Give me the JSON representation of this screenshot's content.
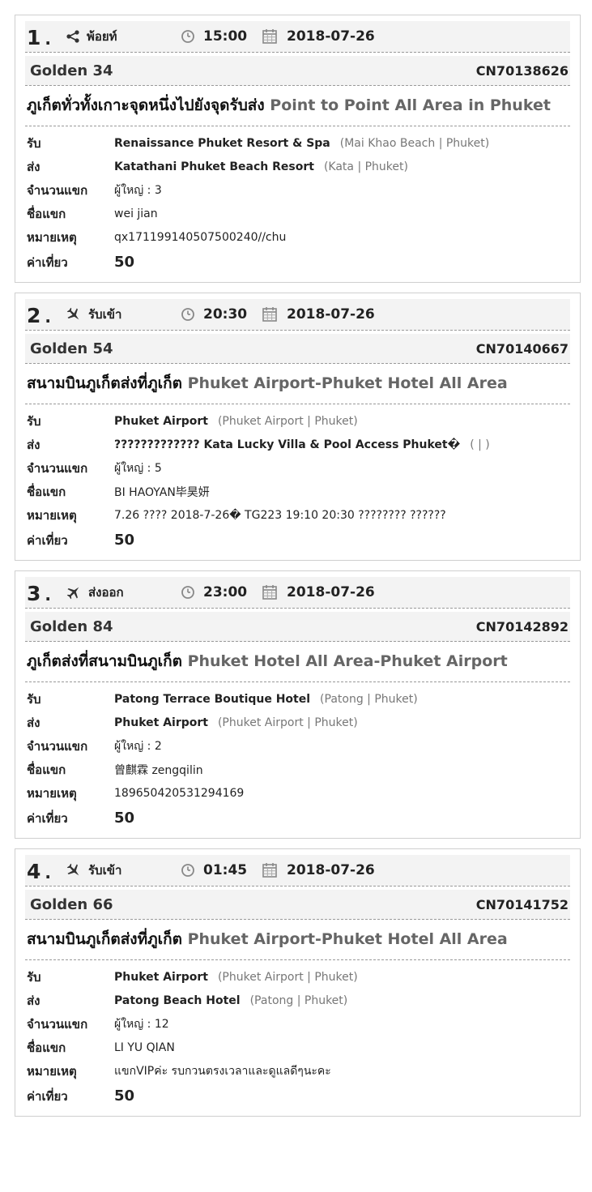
{
  "labels": {
    "pickup": "รับ",
    "dropoff": "ส่ง",
    "guests": "จำนวนแขก",
    "guest_name": "ชื่อแขก",
    "note": "หมายเหตุ",
    "fare": "ค่าเที่ยว"
  },
  "jobs": [
    {
      "number": "1",
      "dot": ".",
      "type_label": "พ้อยท์",
      "type_icon": "share-icon",
      "time": "15:00",
      "date": "2018-07-26",
      "vehicle": "Golden 34",
      "booking_code": "CN70138626",
      "title_th": "ภูเก็ตทั่วทั้งเกาะจุดหนึ่งไปยังจุดรับส่ง",
      "title_en": "Point to Point All Area in Phuket",
      "pickup_name": "Renaissance Phuket Resort & Spa",
      "pickup_loc": "(Mai Khao Beach | Phuket)",
      "dropoff_name": "Katathani Phuket Beach Resort",
      "dropoff_loc": "(Kata | Phuket)",
      "guests": "ผู้ใหญ่ : 3",
      "guest_name": "wei jian",
      "note": "qx171199140507500240//chu",
      "fare": "50"
    },
    {
      "number": "2",
      "dot": ".",
      "type_label": "รับเข้า",
      "type_icon": "plane-arrival-icon",
      "time": "20:30",
      "date": "2018-07-26",
      "vehicle": "Golden 54",
      "booking_code": "CN70140667",
      "title_th": "สนามบินภูเก็ตส่งที่ภูเก็ต",
      "title_en": "Phuket Airport-Phuket Hotel All Area",
      "pickup_name": "Phuket Airport",
      "pickup_loc": "(Phuket Airport | Phuket)",
      "dropoff_name": "????????????? Kata Lucky Villa & Pool Access Phuket�",
      "dropoff_loc": "( | )",
      "guests": "ผู้ใหญ่ : 5",
      "guest_name": "BI HAOYAN毕昊妍",
      "note": "7.26 ???? 2018-7-26� TG223 19:10 20:30 ???????? ??????",
      "fare": "50"
    },
    {
      "number": "3",
      "dot": ".",
      "type_label": "ส่งออก",
      "type_icon": "plane-departure-icon",
      "time": "23:00",
      "date": "2018-07-26",
      "vehicle": "Golden 84",
      "booking_code": "CN70142892",
      "title_th": "ภูเก็ตส่งที่สนามบินภูเก็ต",
      "title_en": "Phuket Hotel All Area-Phuket Airport",
      "pickup_name": "Patong Terrace Boutique Hotel",
      "pickup_loc": "(Patong | Phuket)",
      "dropoff_name": "Phuket Airport",
      "dropoff_loc": "(Phuket Airport | Phuket)",
      "guests": "ผู้ใหญ่ : 2",
      "guest_name": "曾麒霖 zengqilin",
      "note": "189650420531294169",
      "fare": "50"
    },
    {
      "number": "4",
      "dot": ".",
      "type_label": "รับเข้า",
      "type_icon": "plane-arrival-icon",
      "time": "01:45",
      "date": "2018-07-26",
      "vehicle": "Golden 66",
      "booking_code": "CN70141752",
      "title_th": "สนามบินภูเก็ตส่งที่ภูเก็ต",
      "title_en": "Phuket Airport-Phuket Hotel All Area",
      "pickup_name": "Phuket Airport",
      "pickup_loc": "(Phuket Airport | Phuket)",
      "dropoff_name": "Patong Beach Hotel",
      "dropoff_loc": "(Patong | Phuket)",
      "guests": "ผู้ใหญ่ : 12",
      "guest_name": "LI YU QIAN",
      "note": "แขกVIPค่ะ รบกวนตรงเวลาและดูแลดีๆนะคะ",
      "fare": "50"
    }
  ]
}
